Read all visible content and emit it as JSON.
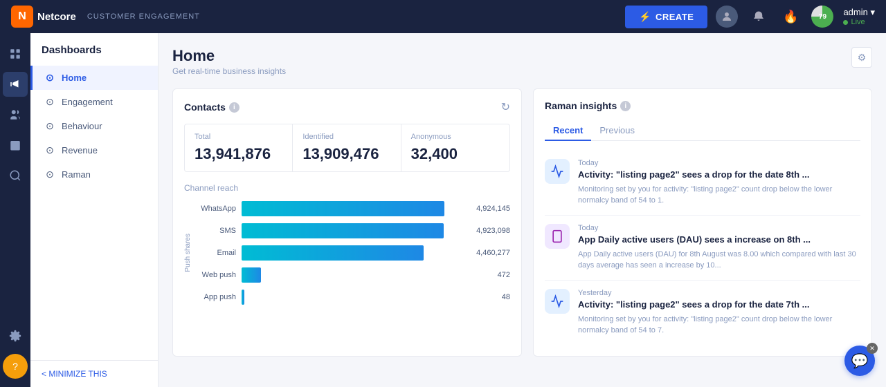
{
  "topnav": {
    "logo": "N",
    "brand": "Netcore",
    "subtitle": "CUSTOMER ENGAGEMENT",
    "create_label": "CREATE",
    "admin_name": "admin ▾",
    "live_label": "Live",
    "score": "79"
  },
  "sidebar": {
    "title": "Dashboards",
    "items": [
      {
        "id": "home",
        "label": "Home",
        "icon": "⊙"
      },
      {
        "id": "engagement",
        "label": "Engagement",
        "icon": "⊙"
      },
      {
        "id": "behaviour",
        "label": "Behaviour",
        "icon": "⊙"
      },
      {
        "id": "revenue",
        "label": "Revenue",
        "icon": "⊙"
      },
      {
        "id": "raman",
        "label": "Raman",
        "icon": "⊙"
      }
    ],
    "minimize_label": "< MINIMIZE THIS"
  },
  "page": {
    "title": "Home",
    "subtitle": "Get real-time business insights"
  },
  "contacts": {
    "card_title": "Contacts",
    "total_label": "Total",
    "total_value": "13,941,876",
    "identified_label": "Identified",
    "identified_value": "13,909,476",
    "anonymous_label": "Anonymous",
    "anonymous_value": "32,400",
    "channel_reach_label": "Channel reach",
    "channels": [
      {
        "name": "WhatsApp",
        "value": 4924145,
        "display": "4,924,145",
        "pct": 90
      },
      {
        "name": "SMS",
        "value": 4923098,
        "display": "4,923,098",
        "pct": 89.8
      },
      {
        "name": "Email",
        "value": 4460277,
        "display": "4,460,277",
        "pct": 81
      },
      {
        "name": "Web push",
        "value": 472,
        "display": "472",
        "pct": 8
      },
      {
        "name": "App push",
        "value": 48,
        "display": "48",
        "pct": 1
      }
    ],
    "y_axis_label": "Push shares"
  },
  "raman": {
    "title": "Raman insights",
    "tabs": [
      "Recent",
      "Previous"
    ],
    "active_tab": "Recent",
    "insights": [
      {
        "date": "Today",
        "title": "Activity: \"listing page2\" sees a drop for the date 8th ...",
        "desc": "Monitoring set by you for activity: \"listing page2\" count drop below the lower normalcy band of 54 to 1.",
        "icon_type": "chart-up",
        "icon_color": "blue"
      },
      {
        "date": "Today",
        "title": "App Daily active users (DAU) sees a increase on 8th ...",
        "desc": "App Daily active users (DAU) for 8th August was 8.00 which compared with last 30 days average has seen a increase by 10...",
        "icon_type": "app",
        "icon_color": "purple"
      },
      {
        "date": "Yesterday",
        "title": "Activity: \"listing page2\" sees a drop for the date 7th ...",
        "desc": "Monitoring set by you for activity: \"listing page2\" count drop below the lower normalcy band of 54 to 7.",
        "icon_type": "chart-up",
        "icon_color": "blue"
      }
    ]
  }
}
